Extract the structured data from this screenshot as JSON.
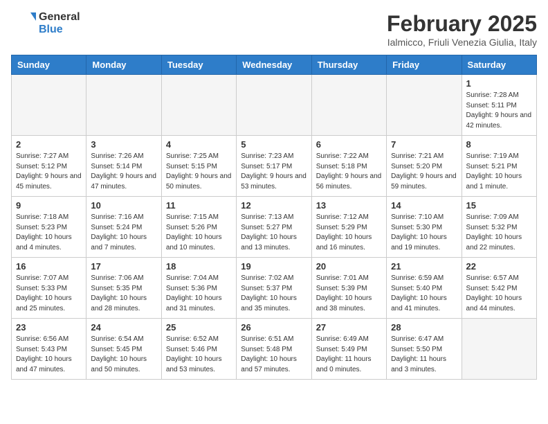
{
  "header": {
    "logo_line1": "General",
    "logo_line2": "Blue",
    "month": "February 2025",
    "location": "Ialmicco, Friuli Venezia Giulia, Italy"
  },
  "days_of_week": [
    "Sunday",
    "Monday",
    "Tuesday",
    "Wednesday",
    "Thursday",
    "Friday",
    "Saturday"
  ],
  "weeks": [
    [
      {
        "num": "",
        "detail": ""
      },
      {
        "num": "",
        "detail": ""
      },
      {
        "num": "",
        "detail": ""
      },
      {
        "num": "",
        "detail": ""
      },
      {
        "num": "",
        "detail": ""
      },
      {
        "num": "",
        "detail": ""
      },
      {
        "num": "1",
        "detail": "Sunrise: 7:28 AM\nSunset: 5:11 PM\nDaylight: 9 hours and 42 minutes."
      }
    ],
    [
      {
        "num": "2",
        "detail": "Sunrise: 7:27 AM\nSunset: 5:12 PM\nDaylight: 9 hours and 45 minutes."
      },
      {
        "num": "3",
        "detail": "Sunrise: 7:26 AM\nSunset: 5:14 PM\nDaylight: 9 hours and 47 minutes."
      },
      {
        "num": "4",
        "detail": "Sunrise: 7:25 AM\nSunset: 5:15 PM\nDaylight: 9 hours and 50 minutes."
      },
      {
        "num": "5",
        "detail": "Sunrise: 7:23 AM\nSunset: 5:17 PM\nDaylight: 9 hours and 53 minutes."
      },
      {
        "num": "6",
        "detail": "Sunrise: 7:22 AM\nSunset: 5:18 PM\nDaylight: 9 hours and 56 minutes."
      },
      {
        "num": "7",
        "detail": "Sunrise: 7:21 AM\nSunset: 5:20 PM\nDaylight: 9 hours and 59 minutes."
      },
      {
        "num": "8",
        "detail": "Sunrise: 7:19 AM\nSunset: 5:21 PM\nDaylight: 10 hours and 1 minute."
      }
    ],
    [
      {
        "num": "9",
        "detail": "Sunrise: 7:18 AM\nSunset: 5:23 PM\nDaylight: 10 hours and 4 minutes."
      },
      {
        "num": "10",
        "detail": "Sunrise: 7:16 AM\nSunset: 5:24 PM\nDaylight: 10 hours and 7 minutes."
      },
      {
        "num": "11",
        "detail": "Sunrise: 7:15 AM\nSunset: 5:26 PM\nDaylight: 10 hours and 10 minutes."
      },
      {
        "num": "12",
        "detail": "Sunrise: 7:13 AM\nSunset: 5:27 PM\nDaylight: 10 hours and 13 minutes."
      },
      {
        "num": "13",
        "detail": "Sunrise: 7:12 AM\nSunset: 5:29 PM\nDaylight: 10 hours and 16 minutes."
      },
      {
        "num": "14",
        "detail": "Sunrise: 7:10 AM\nSunset: 5:30 PM\nDaylight: 10 hours and 19 minutes."
      },
      {
        "num": "15",
        "detail": "Sunrise: 7:09 AM\nSunset: 5:32 PM\nDaylight: 10 hours and 22 minutes."
      }
    ],
    [
      {
        "num": "16",
        "detail": "Sunrise: 7:07 AM\nSunset: 5:33 PM\nDaylight: 10 hours and 25 minutes."
      },
      {
        "num": "17",
        "detail": "Sunrise: 7:06 AM\nSunset: 5:35 PM\nDaylight: 10 hours and 28 minutes."
      },
      {
        "num": "18",
        "detail": "Sunrise: 7:04 AM\nSunset: 5:36 PM\nDaylight: 10 hours and 31 minutes."
      },
      {
        "num": "19",
        "detail": "Sunrise: 7:02 AM\nSunset: 5:37 PM\nDaylight: 10 hours and 35 minutes."
      },
      {
        "num": "20",
        "detail": "Sunrise: 7:01 AM\nSunset: 5:39 PM\nDaylight: 10 hours and 38 minutes."
      },
      {
        "num": "21",
        "detail": "Sunrise: 6:59 AM\nSunset: 5:40 PM\nDaylight: 10 hours and 41 minutes."
      },
      {
        "num": "22",
        "detail": "Sunrise: 6:57 AM\nSunset: 5:42 PM\nDaylight: 10 hours and 44 minutes."
      }
    ],
    [
      {
        "num": "23",
        "detail": "Sunrise: 6:56 AM\nSunset: 5:43 PM\nDaylight: 10 hours and 47 minutes."
      },
      {
        "num": "24",
        "detail": "Sunrise: 6:54 AM\nSunset: 5:45 PM\nDaylight: 10 hours and 50 minutes."
      },
      {
        "num": "25",
        "detail": "Sunrise: 6:52 AM\nSunset: 5:46 PM\nDaylight: 10 hours and 53 minutes."
      },
      {
        "num": "26",
        "detail": "Sunrise: 6:51 AM\nSunset: 5:48 PM\nDaylight: 10 hours and 57 minutes."
      },
      {
        "num": "27",
        "detail": "Sunrise: 6:49 AM\nSunset: 5:49 PM\nDaylight: 11 hours and 0 minutes."
      },
      {
        "num": "28",
        "detail": "Sunrise: 6:47 AM\nSunset: 5:50 PM\nDaylight: 11 hours and 3 minutes."
      },
      {
        "num": "",
        "detail": ""
      }
    ]
  ]
}
